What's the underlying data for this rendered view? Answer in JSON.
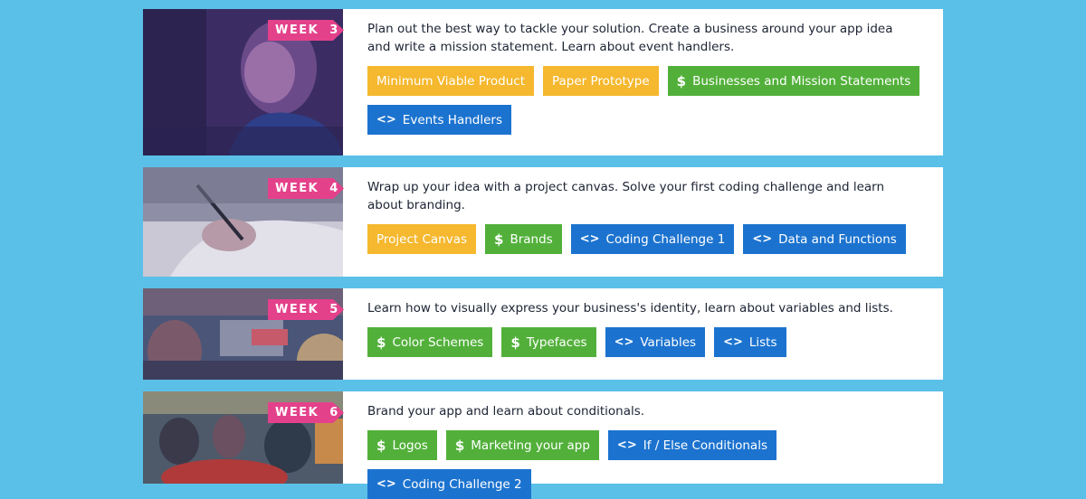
{
  "weeks": [
    {
      "label": "WEEK  3",
      "description": "Plan out the best way to tackle your solution. Create a business around your app idea and write a mission statement. Learn about event handlers.",
      "tags": [
        {
          "label": "Minimum Viable Product",
          "kind": "yellow",
          "icon": ""
        },
        {
          "label": "Paper Prototype",
          "kind": "yellow",
          "icon": ""
        },
        {
          "label": "Businesses and Mission Statements",
          "kind": "green",
          "icon": "$"
        },
        {
          "label": "Events Handlers",
          "kind": "blue",
          "icon": "<>"
        }
      ]
    },
    {
      "label": "WEEK  4",
      "description": "Wrap up your idea with a project canvas. Solve your first coding challenge and learn about branding.",
      "tags": [
        {
          "label": "Project Canvas",
          "kind": "yellow",
          "icon": ""
        },
        {
          "label": "Brands",
          "kind": "green",
          "icon": "$"
        },
        {
          "label": "Coding Challenge 1",
          "kind": "blue",
          "icon": "<>"
        },
        {
          "label": "Data and Functions",
          "kind": "blue",
          "icon": "<>"
        }
      ]
    },
    {
      "label": "WEEK  5",
      "description": "Learn how to visually express your business's identity, learn about variables and lists.",
      "tags": [
        {
          "label": "Color Schemes",
          "kind": "green",
          "icon": "$"
        },
        {
          "label": "Typefaces",
          "kind": "green",
          "icon": "$"
        },
        {
          "label": "Variables",
          "kind": "blue",
          "icon": "<>"
        },
        {
          "label": "Lists",
          "kind": "blue",
          "icon": "<>"
        }
      ]
    },
    {
      "label": "WEEK  6",
      "description": "Brand your app and learn about conditionals.",
      "tags": [
        {
          "label": "Logos",
          "kind": "green",
          "icon": "$"
        },
        {
          "label": "Marketing your app",
          "kind": "green",
          "icon": "$"
        },
        {
          "label": "If / Else Conditionals",
          "kind": "blue",
          "icon": "<>"
        },
        {
          "label": "Coding Challenge 2",
          "kind": "blue",
          "icon": "<>"
        }
      ]
    }
  ],
  "colors": {
    "background": "#5bc0e8",
    "week_tag": "#e4418b",
    "yellow_tag": "#f5b82e",
    "green_tag": "#52b03a",
    "blue_tag": "#1c73cf",
    "photo_tint": "#3a2a5e"
  },
  "icon_names": {
    "$": "dollar-icon",
    "<>": "code-icon"
  }
}
